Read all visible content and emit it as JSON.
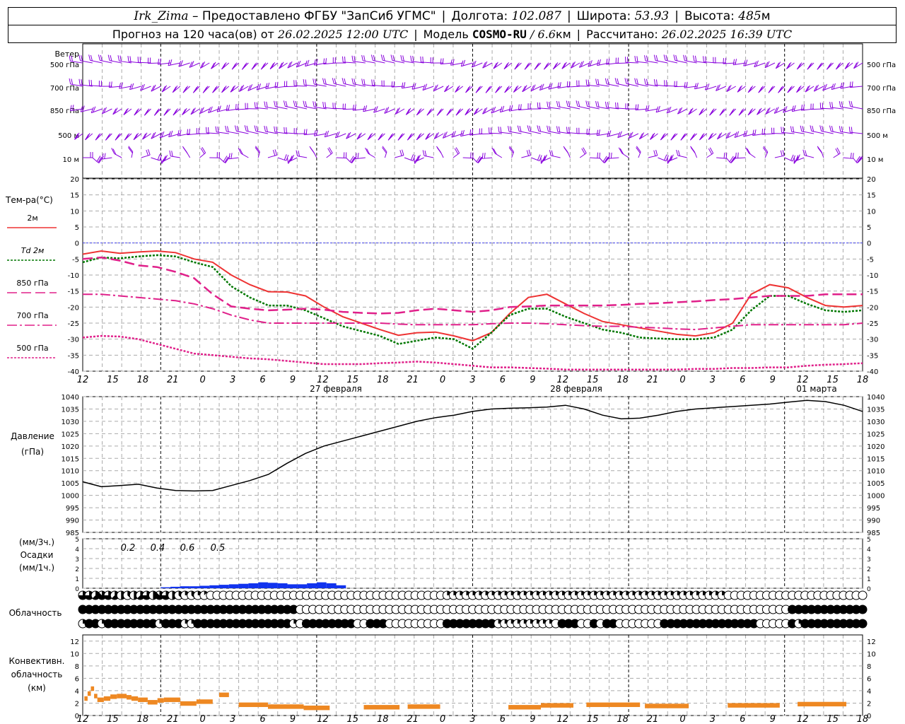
{
  "header": {
    "station": "Irk_Zima",
    "provided_label": "– Предоставлено ФГБУ \"ЗапСиб УГМС\"",
    "lon_label": "Долгота:",
    "lon_value": "102.087",
    "lat_label": "Широта:",
    "lat_value": "53.93",
    "alt_label": "Высота:",
    "alt_value": "485",
    "alt_unit": "м",
    "forecast_label": "Прогноз на 120 часа(ов) от",
    "forecast_from": "26.02.2025 12:00 UTC",
    "model_label": "Модель",
    "model_name": "COSMO-RU",
    "model_res": "/ 6.6",
    "model_res_unit": "км",
    "calc_label": "Рассчитано:",
    "calc_value": "26.02.2025 16:39 UTC"
  },
  "colors": {
    "t2m": "#ee3333",
    "td2m": "#007700",
    "t850": "#e0208a",
    "t700": "#e0208a",
    "t500": "#e0208a",
    "zero_line": "#4444ee",
    "wind": "#8800dd",
    "precip": "#1133ee",
    "conv_cloud": "#ee8822"
  },
  "chart_data": [
    {
      "type": "line",
      "panel": "wind",
      "row_labels": [
        "Ветер",
        "500 гПа",
        "700 гПа",
        "850 гПа",
        "500 м",
        "10 м"
      ],
      "right_labels": [
        "500 гПа",
        "700 гПа",
        "850 гПа",
        "500 м",
        "10 м"
      ]
    },
    {
      "type": "line",
      "panel": "temperature",
      "ylabel": "Тем-ра(°С)",
      "ylim": [
        -40,
        20
      ],
      "yticks": [
        20,
        15,
        10,
        5,
        0,
        -5,
        -10,
        -15,
        -20,
        -25,
        -30,
        -35,
        -40
      ],
      "x_hours": [
        12,
        15,
        18,
        21,
        0,
        3,
        6,
        9,
        12,
        15,
        18,
        21,
        0,
        3,
        6,
        9,
        12,
        15,
        18,
        21,
        0,
        3,
        6,
        9,
        12,
        15,
        18
      ],
      "date_labels": [
        "27 февраля",
        "28 февраля",
        "01 марта"
      ],
      "series": [
        {
          "name": "2м",
          "values": [
            -3.5,
            -2.5,
            -3.2,
            -2.8,
            -2.5,
            -3.0,
            -5.0,
            -6.0,
            -10.0,
            -13.0,
            -15.2,
            -15.3,
            -16.5,
            -20.0,
            -23.0,
            -25.0,
            -27.0,
            -28.8,
            -28.0,
            -27.8,
            -29.0,
            -30.5,
            -28.0,
            -22.0,
            -17.0,
            -16.0,
            -19.0,
            -22.0,
            -24.5,
            -25.5,
            -26.5,
            -27.5,
            -28.5,
            -29.0,
            -28.0,
            -25.0,
            -16.0,
            -13.0,
            -14.0,
            -17.0,
            -19.5,
            -20.0,
            -19.5
          ]
        },
        {
          "name": "Td 2м",
          "values": [
            -6.0,
            -4.5,
            -4.8,
            -4.2,
            -3.8,
            -4.2,
            -6.0,
            -7.5,
            -13.5,
            -17.0,
            -19.5,
            -19.5,
            -21.0,
            -23.5,
            -26.0,
            -27.5,
            -29.0,
            -31.5,
            -30.5,
            -29.5,
            -30.0,
            -33.0,
            -28.0,
            -22.5,
            -20.5,
            -20.5,
            -23.0,
            -25.0,
            -27.0,
            -28.0,
            -29.5,
            -29.8,
            -30.0,
            -30.0,
            -29.5,
            -27.0,
            -21.0,
            -16.5,
            -16.5,
            -19.0,
            -21.0,
            -21.5,
            -21.0
          ]
        },
        {
          "name": "850 гПа",
          "values": [
            -5.0,
            -4.5,
            -5.5,
            -7.0,
            -7.5,
            -9.0,
            -11.0,
            -16.0,
            -19.8,
            -20.5,
            -21.0,
            -20.8,
            -20.5,
            -20.8,
            -21.5,
            -21.8,
            -22.0,
            -21.8,
            -21.0,
            -20.5,
            -21.0,
            -21.5,
            -21.0,
            -20.0,
            -19.8,
            -19.5,
            -19.5,
            -19.5,
            -19.5,
            -19.3,
            -19.0,
            -18.8,
            -18.5,
            -18.2,
            -17.8,
            -17.5,
            -17.0,
            -16.5,
            -16.5,
            -16.5,
            -16.0,
            -16.0,
            -16.0
          ]
        },
        {
          "name": "700 гПа",
          "values": [
            -16.0,
            -16.0,
            -16.5,
            -17.0,
            -17.5,
            -18.0,
            -19.0,
            -20.5,
            -22.5,
            -24.0,
            -25.0,
            -25.0,
            -25.0,
            -25.0,
            -25.0,
            -25.0,
            -25.0,
            -25.3,
            -25.5,
            -25.5,
            -25.5,
            -25.5,
            -25.2,
            -25.0,
            -25.0,
            -25.2,
            -25.5,
            -25.8,
            -26.0,
            -26.0,
            -26.3,
            -26.5,
            -26.8,
            -27.0,
            -26.5,
            -26.0,
            -25.5,
            -25.5,
            -25.5,
            -25.5,
            -25.5,
            -25.5,
            -25.0
          ]
        },
        {
          "name": "500 гПа",
          "values": [
            -29.5,
            -29.0,
            -29.2,
            -30.0,
            -31.5,
            -33.0,
            -34.5,
            -35.0,
            -35.5,
            -36.0,
            -36.3,
            -36.8,
            -37.3,
            -37.8,
            -37.8,
            -37.8,
            -37.5,
            -37.3,
            -37.0,
            -37.3,
            -37.8,
            -38.3,
            -38.8,
            -38.8,
            -39.0,
            -39.2,
            -39.5,
            -39.5,
            -39.5,
            -39.5,
            -39.5,
            -39.5,
            -39.5,
            -39.3,
            -39.3,
            -39.0,
            -39.0,
            -38.8,
            -38.8,
            -38.3,
            -38.0,
            -37.8,
            -37.5
          ]
        }
      ]
    },
    {
      "type": "line",
      "panel": "pressure",
      "ylabel": "Давление",
      "ylabel2": "(гПа)",
      "ylim": [
        985,
        1040
      ],
      "yticks": [
        1040,
        1035,
        1030,
        1025,
        1020,
        1015,
        1010,
        1005,
        1000,
        995,
        990,
        985
      ],
      "series": [
        {
          "name": "Давление",
          "values": [
            1005.5,
            1003.5,
            1004.0,
            1004.5,
            1003.0,
            1002.0,
            1001.8,
            1002.0,
            1004.0,
            1006.0,
            1008.5,
            1013.0,
            1017.0,
            1020.0,
            1022.0,
            1024.0,
            1026.0,
            1028.0,
            1030.0,
            1031.5,
            1032.5,
            1034.0,
            1035.0,
            1035.3,
            1035.5,
            1035.8,
            1036.5,
            1035.0,
            1032.5,
            1031.0,
            1031.3,
            1032.5,
            1034.0,
            1035.0,
            1035.5,
            1036.0,
            1036.5,
            1037.0,
            1037.8,
            1038.5,
            1038.0,
            1036.5,
            1034.0
          ]
        }
      ]
    },
    {
      "type": "bar",
      "panel": "precipitation",
      "ylabel": "Осадки",
      "unit_top": "(мм/3ч.)",
      "unit_bottom": "(мм/1ч.)",
      "ylim": [
        0,
        5
      ],
      "yticks": [
        5,
        4,
        3,
        2,
        1,
        0
      ],
      "sum_labels": [
        "0.2",
        "0.4",
        "0.6",
        "0.5"
      ],
      "values": [
        0,
        0,
        0,
        0,
        0,
        0,
        0,
        0,
        0.1,
        0.15,
        0.2,
        0.2,
        0.25,
        0.3,
        0.35,
        0.4,
        0.45,
        0.5,
        0.6,
        0.55,
        0.5,
        0.4,
        0.4,
        0.5,
        0.6,
        0.5,
        0.3,
        0,
        0
      ]
    },
    {
      "type": "table",
      "panel": "cloudiness",
      "ylabel": "Облачность",
      "rows": [
        [
          6,
          6,
          5,
          7,
          6,
          5,
          4,
          3,
          4,
          5,
          6,
          4,
          7,
          6,
          4,
          3,
          2,
          3,
          2,
          1,
          0,
          0,
          0,
          0,
          0,
          0,
          0,
          0,
          0,
          0,
          0,
          0,
          0,
          0,
          0,
          0,
          0,
          0,
          0,
          0,
          0,
          0,
          0,
          0,
          0,
          0,
          0,
          0,
          0,
          0,
          0,
          0,
          0,
          0,
          0,
          0,
          0,
          2,
          2,
          2,
          2,
          2,
          2,
          2,
          2,
          2,
          2,
          2,
          2,
          2,
          2,
          2,
          2,
          2,
          2,
          2,
          2,
          2,
          2,
          2,
          2,
          2,
          2,
          2,
          2,
          2,
          2,
          2,
          2,
          2,
          2,
          2,
          2,
          2,
          2,
          2,
          2,
          2,
          2,
          2,
          2,
          0,
          0,
          0,
          0,
          0,
          0,
          0,
          0,
          0,
          0,
          0,
          0,
          0,
          0,
          0,
          0,
          0,
          0,
          0,
          0,
          0,
          0
        ],
        [
          8,
          8,
          8,
          8,
          8,
          8,
          8,
          8,
          8,
          8,
          8,
          8,
          8,
          8,
          8,
          8,
          8,
          8,
          8,
          8,
          8,
          8,
          8,
          8,
          8,
          8,
          8,
          8,
          8,
          8,
          8,
          8,
          8,
          8,
          0,
          0,
          0,
          0,
          0,
          0,
          0,
          0,
          0,
          0,
          0,
          0,
          0,
          0,
          0,
          0,
          0,
          0,
          0,
          0,
          0,
          0,
          0,
          0,
          0,
          0,
          0,
          0,
          0,
          0,
          0,
          0,
          0,
          0,
          0,
          0,
          0,
          0,
          0,
          0,
          0,
          0,
          0,
          0,
          0,
          0,
          0,
          0,
          0,
          0,
          0,
          0,
          0,
          0,
          0,
          0,
          0,
          0,
          0,
          0,
          0,
          0,
          0,
          0,
          0,
          0,
          0,
          0,
          0,
          0,
          0,
          0,
          0,
          0,
          0,
          0,
          0,
          8,
          8,
          8,
          8,
          8,
          8,
          8,
          8,
          8,
          8,
          8,
          8
        ],
        [
          2,
          8,
          8,
          2,
          8,
          8,
          8,
          8,
          8,
          8,
          8,
          8,
          2,
          8,
          8,
          8,
          2,
          2,
          8,
          8,
          8,
          8,
          8,
          8,
          8,
          8,
          8,
          8,
          8,
          8,
          8,
          8,
          8,
          2,
          0,
          8,
          8,
          8,
          8,
          8,
          8,
          8,
          8,
          0,
          0,
          8,
          8,
          8,
          0,
          0,
          0,
          0,
          0,
          0,
          0,
          0,
          0,
          8,
          8,
          8,
          8,
          8,
          8,
          8,
          8,
          2,
          2,
          2,
          2,
          2,
          2,
          2,
          2,
          2,
          0,
          8,
          8,
          8,
          0,
          0,
          8,
          0,
          8,
          8,
          0,
          0,
          0,
          0,
          0,
          0,
          0,
          8,
          8,
          8,
          8,
          8,
          8,
          8,
          8,
          8,
          8,
          8,
          8,
          8,
          8,
          8,
          0,
          0,
          0,
          0,
          0,
          8,
          2,
          8,
          8,
          8,
          8,
          8,
          8,
          8,
          8,
          8,
          8
        ]
      ]
    },
    {
      "type": "bar",
      "panel": "convective_cloud",
      "ylabel": "Конвективн.",
      "ylabel2": "облачность",
      "ylabel3": "(км)",
      "ylim": [
        0,
        13
      ],
      "yticks": [
        12,
        10,
        8,
        6,
        4,
        2,
        0
      ],
      "x_hours": [
        12,
        15,
        18,
        21,
        0,
        3,
        6,
        9,
        12,
        15,
        18,
        21,
        0,
        3,
        6,
        9,
        12,
        15,
        18,
        21,
        0,
        3,
        6,
        9,
        12,
        15,
        18
      ]
    }
  ]
}
